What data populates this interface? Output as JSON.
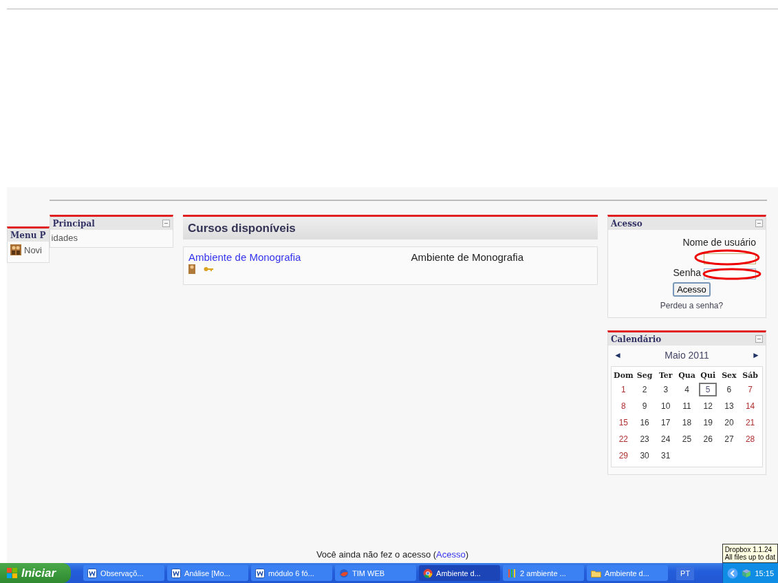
{
  "left_block": {
    "title": "Menu P",
    "items": [
      {
        "label": "Novi"
      }
    ]
  },
  "principal_block": {
    "title": "Principal",
    "items": [
      {
        "label": "idades"
      }
    ]
  },
  "courses": {
    "title": "Cursos disponíveis",
    "items": [
      {
        "name": "Ambiente de Monografia",
        "summary": "Ambiente de Monografia"
      }
    ]
  },
  "login": {
    "title": "Acesso",
    "username_label": "Nome de usuário",
    "password_label": "Senha",
    "submit": "Acesso",
    "forgot": "Perdeu a senha?"
  },
  "calendar": {
    "title": "Calendário",
    "month": "Maio 2011",
    "prev": "◄",
    "next": "►",
    "weekdays": [
      "Dom",
      "Seg",
      "Ter",
      "Qua",
      "Qui",
      "Sex",
      "Sáb"
    ],
    "weeks": [
      [
        {
          "day": "1",
          "weekend": true,
          "today": false
        },
        {
          "day": "2",
          "weekend": false,
          "today": false
        },
        {
          "day": "3",
          "weekend": false,
          "today": false
        },
        {
          "day": "4",
          "weekend": false,
          "today": false
        },
        {
          "day": "5",
          "weekend": false,
          "today": true
        },
        {
          "day": "6",
          "weekend": false,
          "today": false
        },
        {
          "day": "7",
          "weekend": true,
          "today": false
        }
      ],
      [
        {
          "day": "8",
          "weekend": true,
          "today": false
        },
        {
          "day": "9",
          "weekend": false,
          "today": false
        },
        {
          "day": "10",
          "weekend": false,
          "today": false
        },
        {
          "day": "11",
          "weekend": false,
          "today": false
        },
        {
          "day": "12",
          "weekend": false,
          "today": false
        },
        {
          "day": "13",
          "weekend": false,
          "today": false
        },
        {
          "day": "14",
          "weekend": true,
          "today": false
        }
      ],
      [
        {
          "day": "15",
          "weekend": true,
          "today": false
        },
        {
          "day": "16",
          "weekend": false,
          "today": false
        },
        {
          "day": "17",
          "weekend": false,
          "today": false
        },
        {
          "day": "18",
          "weekend": false,
          "today": false
        },
        {
          "day": "19",
          "weekend": false,
          "today": false
        },
        {
          "day": "20",
          "weekend": false,
          "today": false
        },
        {
          "day": "21",
          "weekend": true,
          "today": false
        }
      ],
      [
        {
          "day": "22",
          "weekend": true,
          "today": false
        },
        {
          "day": "23",
          "weekend": false,
          "today": false
        },
        {
          "day": "24",
          "weekend": false,
          "today": false
        },
        {
          "day": "25",
          "weekend": false,
          "today": false
        },
        {
          "day": "26",
          "weekend": false,
          "today": false
        },
        {
          "day": "27",
          "weekend": false,
          "today": false
        },
        {
          "day": "28",
          "weekend": true,
          "today": false
        }
      ],
      [
        {
          "day": "29",
          "weekend": true,
          "today": false
        },
        {
          "day": "30",
          "weekend": false,
          "today": false
        },
        {
          "day": "31",
          "weekend": false,
          "today": false
        }
      ]
    ]
  },
  "footer": {
    "text": "Você ainda não fez o acesso (",
    "link": "Acesso",
    "after": ")"
  },
  "taskbar": {
    "start": "Iniciar",
    "tasks": [
      {
        "label": "Observaçõ...",
        "kind": "word",
        "selected": false
      },
      {
        "label": "Análise [Mo...",
        "kind": "word",
        "selected": false
      },
      {
        "label": "módulo 6 fó...",
        "kind": "word",
        "selected": false
      },
      {
        "label": "TIM WEB",
        "kind": "globe",
        "selected": false
      },
      {
        "label": "Ambiente d...",
        "kind": "chrome",
        "selected": true
      },
      {
        "label": "2 ambiente ...",
        "kind": "paint",
        "selected": false
      },
      {
        "label": "Ambiente d...",
        "kind": "folder",
        "selected": false
      }
    ],
    "language": "PT",
    "clock": "15:15"
  },
  "tooltip": {
    "lines": [
      "Dropbox 1.1.24",
      "All files up to dat"
    ]
  }
}
